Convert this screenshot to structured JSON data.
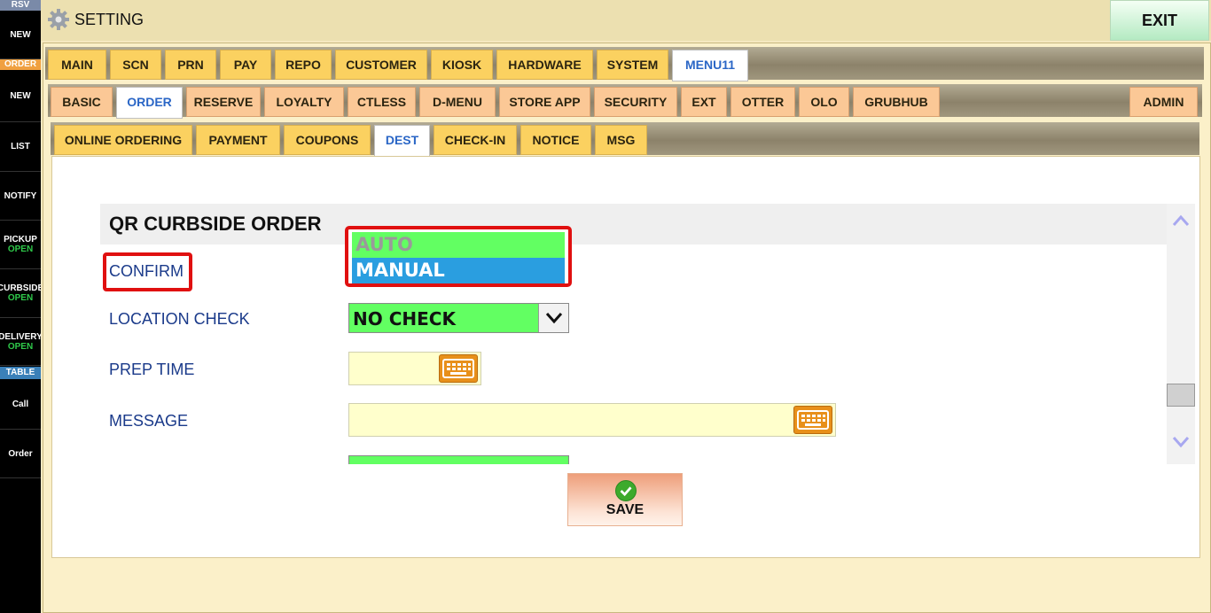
{
  "sidebar": {
    "rsv": "RSV",
    "order_header": "ORDER",
    "table_header": "TABLE",
    "items": [
      {
        "label": "NEW",
        "sub": ""
      },
      {
        "label": "NEW",
        "sub": ""
      },
      {
        "label": "LIST",
        "sub": ""
      },
      {
        "label": "NOTIFY",
        "sub": ""
      },
      {
        "label": "PICKUP",
        "sub": "OPEN"
      },
      {
        "label": "CURBSIDE",
        "sub": "OPEN"
      },
      {
        "label": "DELIVERY",
        "sub": "OPEN"
      },
      {
        "label": "Call",
        "sub": ""
      },
      {
        "label": "Order",
        "sub": ""
      }
    ]
  },
  "header": {
    "title": "SETTING",
    "exit_label": "EXIT"
  },
  "tabs_level1": [
    "MAIN",
    "SCN",
    "PRN",
    "PAY",
    "REPO",
    "CUSTOMER",
    "KIOSK",
    "HARDWARE",
    "SYSTEM",
    "MENU11"
  ],
  "tabs_level2": [
    "BASIC",
    "ORDER",
    "RESERVE",
    "LOYALTY",
    "CTLESS",
    "D-MENU",
    "STORE APP",
    "SECURITY",
    "EXT",
    "OTTER",
    "OLO",
    "GRUBHUB"
  ],
  "admin_label": "ADMIN",
  "tabs_level3": [
    "ONLINE ORDERING",
    "PAYMENT",
    "COUPONS",
    "DEST",
    "CHECK-IN",
    "NOTICE",
    "MSG"
  ],
  "section": {
    "title": "QR CURBSIDE ORDER",
    "confirm_label": "CONFIRM",
    "confirm_options": [
      "AUTO",
      "MANUAL"
    ],
    "location_check_label": "LOCATION CHECK",
    "location_check_value": "NO CHECK",
    "prep_time_label": "PREP TIME",
    "prep_time_value": "",
    "message_label": "MESSAGE",
    "message_value": ""
  },
  "save_label": "SAVE",
  "colors": {
    "select_green": "#62ff62",
    "selected_blue": "#2a9ee0",
    "highlight_red": "#e01010",
    "tab_yellow": "#fbd160",
    "tab_salmon": "#fbc896",
    "active_tab_text": "#2a66c6"
  }
}
